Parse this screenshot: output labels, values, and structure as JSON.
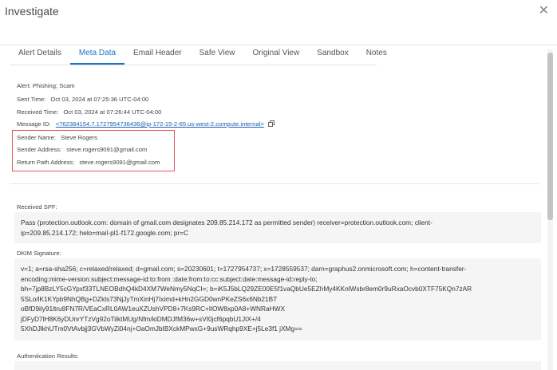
{
  "window": {
    "title": "Investigate",
    "close_icon": "close-icon"
  },
  "tabs": [
    {
      "label": "Alert Details",
      "active": false
    },
    {
      "label": "Meta Data",
      "active": true
    },
    {
      "label": "Email Header",
      "active": false
    },
    {
      "label": "Safe View",
      "active": false
    },
    {
      "label": "Original View",
      "active": false
    },
    {
      "label": "Sandbox",
      "active": false
    },
    {
      "label": "Notes",
      "active": false
    }
  ],
  "meta": {
    "alert": {
      "label": "Alert:",
      "value": "Phishing; Scam"
    },
    "sent_time": {
      "label": "Sent Time:",
      "value": "Oct 03, 2024 at 07:25:36 UTC-04:00"
    },
    "received_time": {
      "label": "Received Time:",
      "value": "Oct 03, 2024 at 07:26:44 UTC-04:00"
    },
    "message_id": {
      "label": "Message ID:",
      "value": "<762384154.7.1727954736436@ip-172-15-2-65.us-west-2.compute.internal>",
      "copy_icon": "copy-icon"
    },
    "sender_name": {
      "label": "Sender Name:",
      "value": "Steve Rogers"
    },
    "sender_address": {
      "label": "Sender Address:",
      "value": "steve.rogers9091@gmail.com"
    },
    "return_path": {
      "label": "Return Path Address:",
      "value": "steve.rogers9091@gmail.com"
    }
  },
  "received_spf": {
    "label": "Received SPF:",
    "lines": [
      "Pass (protection.outlook.com: domain of gmail.com designates 209.85.214.172 as permitted sender) receiver=protection.outlook.com; client-",
      "ip=209.85.214.172; helo=mail-pl1-f172.google.com; pr=C"
    ]
  },
  "dkim": {
    "label": "DKIM Signature:",
    "lines": [
      "v=1; a=rsa-sha256; c=relaxed/relaxed; d=gmail.com; s=20230601; t=1727954737; x=1728559537; darn=graphus2.onmicrosoft.com; h=content-transfer-",
      "encoding:mime-version:subject:message-id:to:from :date:from:to:cc:subject:date:message-id:reply-to;",
      "bh=7jp8BzLY5cGYpxf33TLNEOBdhQ4kD4XM7WeNmy5NqCI=; b=iK5J5bLQ29ZE00E5f1vaQbUe5EZhMy4KKnlWsbr8em0r9uRxaOcvb0XTF75KQn7zAR",
      "5SLo/lK1KYpb9NhQBg+DZkls73NjJyTmXinHj7Iximd+kHn2GGD0wnPKeZS6x6Nb21BT",
      "oBfD9ily91ltru8FN7R/VEaCxRL0AW1euXZUshVPD8+7Ks9RC+IlOW8xp0A8+WNRaHWX",
      "jDFyD7lH8K6yDUnrYTzVg92oTilktMUg/Nfm/kiDMDJfM36w+sVI0jcf6pqbU1JtX+/4",
      "5XhDJlkhUTm0VtAvbjj3GVbWyZi04nj+OaOmJbIBXckMPwxG+9usWRqhp9XE+j5Le3f1 jXMg=="
    ]
  },
  "authentication_results": {
    "label": "Authentication Results:"
  }
}
